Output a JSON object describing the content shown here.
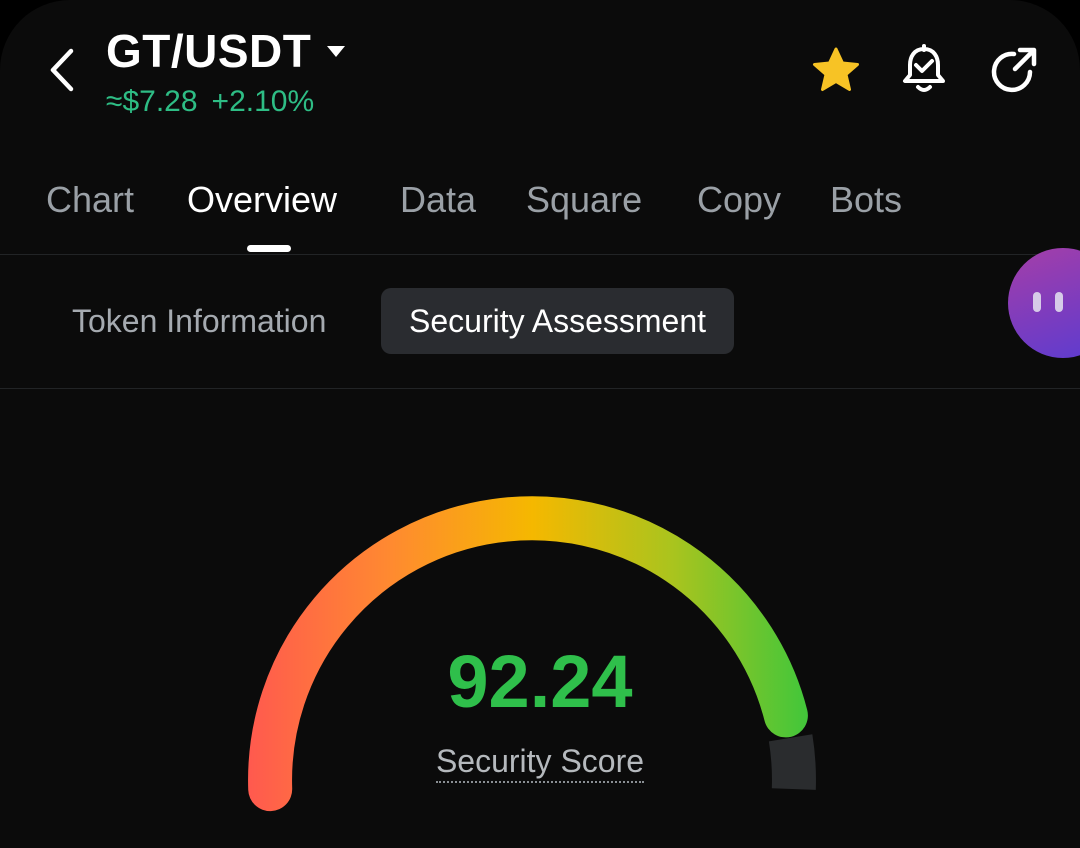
{
  "header": {
    "pair": "GT/USDT",
    "price": "≈$7.28",
    "change": "+2.10%",
    "icons": [
      "chevron-left-icon",
      "caret-down-icon",
      "star-icon",
      "bell-check-icon",
      "share-icon"
    ],
    "colors": {
      "positive": "#2ebd85",
      "favorite": "#f7c325"
    }
  },
  "tabs": [
    {
      "label": "Chart",
      "active": false
    },
    {
      "label": "Overview",
      "active": true
    },
    {
      "label": "Data",
      "active": false
    },
    {
      "label": "Square",
      "active": false
    },
    {
      "label": "Copy",
      "active": false
    },
    {
      "label": "Bots",
      "active": false
    }
  ],
  "subtabs": [
    {
      "label": "Token Information",
      "active": false
    },
    {
      "label": "Security Assessment",
      "active": true
    }
  ],
  "security": {
    "score": "92.24",
    "score_fraction": 0.9224,
    "label": "Security Score",
    "colors": {
      "score": "#2fbf4b",
      "low": "#ff5a4e",
      "mid": "#f5b800",
      "high": "#3cc63c",
      "track": "#2a2c2e"
    }
  }
}
